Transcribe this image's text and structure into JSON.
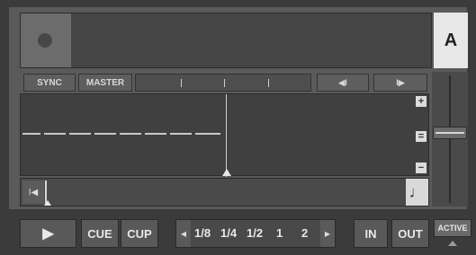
{
  "deck": {
    "letter": "A"
  },
  "buttons": {
    "sync": "SYNC",
    "master": "MASTER",
    "cue": "CUE",
    "cup": "CUP",
    "loop_in": "IN",
    "loop_out": "OUT",
    "active": "ACTIVE"
  },
  "waveform_zoom": {
    "plus": "+",
    "equals": "=",
    "minus": "−"
  },
  "loop_sizes": [
    "1/8",
    "1/4",
    "1/2",
    "1",
    "2"
  ],
  "icons": {
    "play": "play-icon",
    "back": "prev-icon",
    "forward": "next-icon",
    "rewind": "rewind-icon",
    "note": "note-icon",
    "loop_prev": "loop-size-prev-icon",
    "loop_next": "loop-size-next-icon"
  }
}
